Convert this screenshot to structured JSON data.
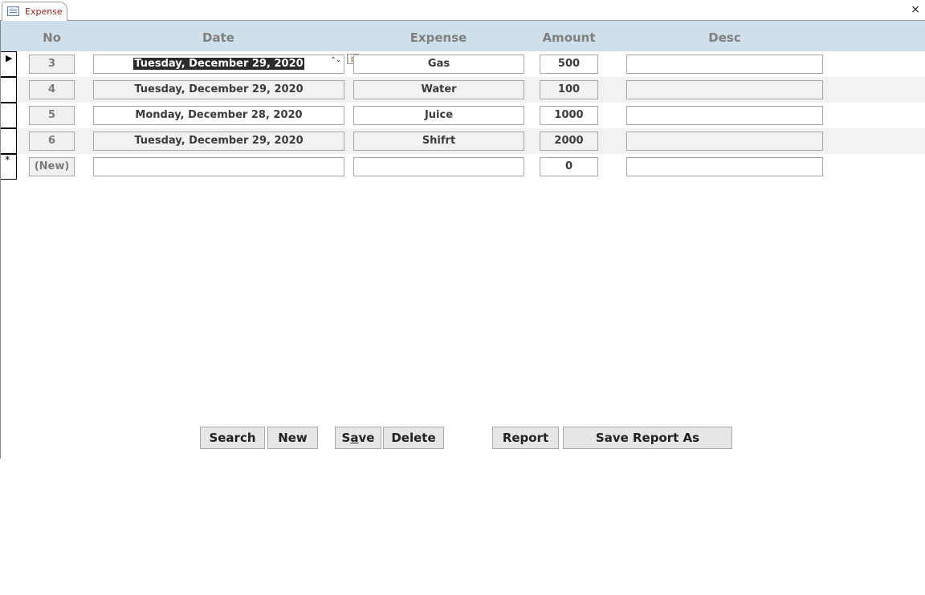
{
  "tab": {
    "title": "Expense",
    "close": "×"
  },
  "headers": {
    "no": "No",
    "date": "Date",
    "expense": "Expense",
    "amount": "Amount",
    "desc": "Desc"
  },
  "rows": [
    {
      "no": "3",
      "date": "Tuesday, December 29, 2020",
      "expense": "Gas",
      "amount": "500",
      "desc": ""
    },
    {
      "no": "4",
      "date": "Tuesday, December 29, 2020",
      "expense": "Water",
      "amount": "100",
      "desc": ""
    },
    {
      "no": "5",
      "date": "Monday, December 28, 2020",
      "expense": "Juice",
      "amount": "1000",
      "desc": ""
    },
    {
      "no": "6",
      "date": "Tuesday, December 29, 2020",
      "expense": "Shifrt",
      "amount": "2000",
      "desc": ""
    }
  ],
  "new_row": {
    "marker": "*",
    "no": "(New)",
    "date": "",
    "expense": "",
    "amount": "0",
    "desc": ""
  },
  "current_marker": "▶",
  "spinner": "⌃⌄",
  "buttons": {
    "search": "Search",
    "new": "New",
    "save_pre": "S",
    "save_accel": "a",
    "save_post": "ve",
    "delete": "Delete",
    "report": "Report",
    "save_report_as": "Save Report As"
  }
}
